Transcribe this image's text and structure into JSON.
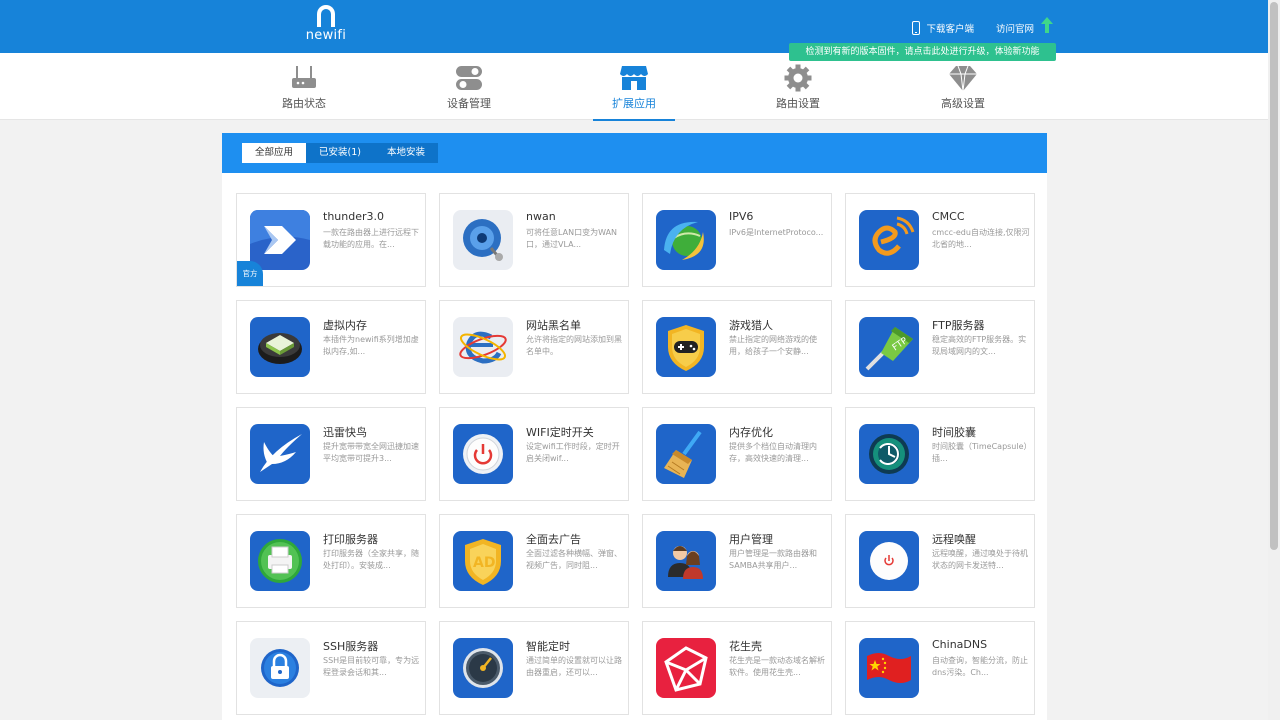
{
  "header": {
    "logo_text": "newifi",
    "download_client": "下载客户端",
    "visit_site": "访问官网",
    "upgrade_tip": "检测到有新的版本固件，请点击此处进行升级，体验新功能"
  },
  "nav": {
    "items": [
      {
        "label": "路由状态",
        "icon": "router-icon"
      },
      {
        "label": "设备管理",
        "icon": "toggle-icon"
      },
      {
        "label": "扩展应用",
        "icon": "store-icon"
      },
      {
        "label": "路由设置",
        "icon": "gear-icon"
      },
      {
        "label": "高级设置",
        "icon": "diamond-icon"
      }
    ],
    "active_index": 2
  },
  "tabs": [
    "全部应用",
    "已安装(1)",
    "本地安装"
  ],
  "apps": [
    {
      "name": "thunder3.0",
      "desc": "一款在路由器上进行远程下载功能的应用。在...",
      "icon": "thunder-icon",
      "badge": "官方"
    },
    {
      "name": "nwan",
      "desc": "可将任意LAN口变为WAN口，通过VLA...",
      "icon": "nwan-icon"
    },
    {
      "name": "IPV6",
      "desc": "IPv6是InternetProtoco...",
      "icon": "ipv6-icon"
    },
    {
      "name": "CMCC",
      "desc": "cmcc-edu自动连接,仅限河北省的地...",
      "icon": "cmcc-icon"
    },
    {
      "name": "虚拟内存",
      "desc": "本插件为newifi系列增加虚拟内存,如...",
      "icon": "virtual-memory-icon"
    },
    {
      "name": "网站黑名单",
      "desc": "允许将指定的网站添加到黑名单中。",
      "icon": "blacklist-icon"
    },
    {
      "name": "游戏猎人",
      "desc": "禁止指定的网络游戏的使用，给孩子一个安静...",
      "icon": "game-hunter-icon"
    },
    {
      "name": "FTP服务器",
      "desc": "稳定高效的FTP服务器。实现局域网内的文...",
      "icon": "ftp-icon"
    },
    {
      "name": "迅雷快鸟",
      "desc": "提升宽带带宽全网迅捷加速平均宽带可提升3...",
      "icon": "swift-bird-icon"
    },
    {
      "name": "WIFI定时开关",
      "desc": "设定wifi工作时段，定时开启关闭wif...",
      "icon": "wifi-timer-icon"
    },
    {
      "name": "内存优化",
      "desc": "提供多个档位自动清理内存，高效快速的清理...",
      "icon": "broom-icon"
    },
    {
      "name": "时间胶囊",
      "desc": "时间胶囊（TimeCapsule）插...",
      "icon": "time-capsule-icon"
    },
    {
      "name": "打印服务器",
      "desc": "打印服务器（全家共享，随处打印）。安装成...",
      "icon": "printer-icon"
    },
    {
      "name": "全面去广告",
      "desc": "全面过滤各种横幅、弹窗、视频广告，同时阻...",
      "icon": "adblock-icon"
    },
    {
      "name": "用户管理",
      "desc": "用户管理是一款路由器和SAMBA共享用户...",
      "icon": "users-icon"
    },
    {
      "name": "远程唤醒",
      "desc": "远程唤醒，通过唤处于待机状态的网卡发送特...",
      "icon": "power-icon"
    },
    {
      "name": "SSH服务器",
      "desc": "SSH是目前较可靠，专为远程登录会话和其...",
      "icon": "lock-icon"
    },
    {
      "name": "智能定时",
      "desc": "通过简单的设置就可以让路由器重启，还可以...",
      "icon": "gauge-icon"
    },
    {
      "name": "花生壳",
      "desc": "花生壳是一款动态域名解析软件。使用花生壳...",
      "icon": "peanut-icon"
    },
    {
      "name": "ChinaDNS",
      "desc": "自动查询，智能分流，防止dns污染。Ch...",
      "icon": "china-flag-icon"
    }
  ]
}
